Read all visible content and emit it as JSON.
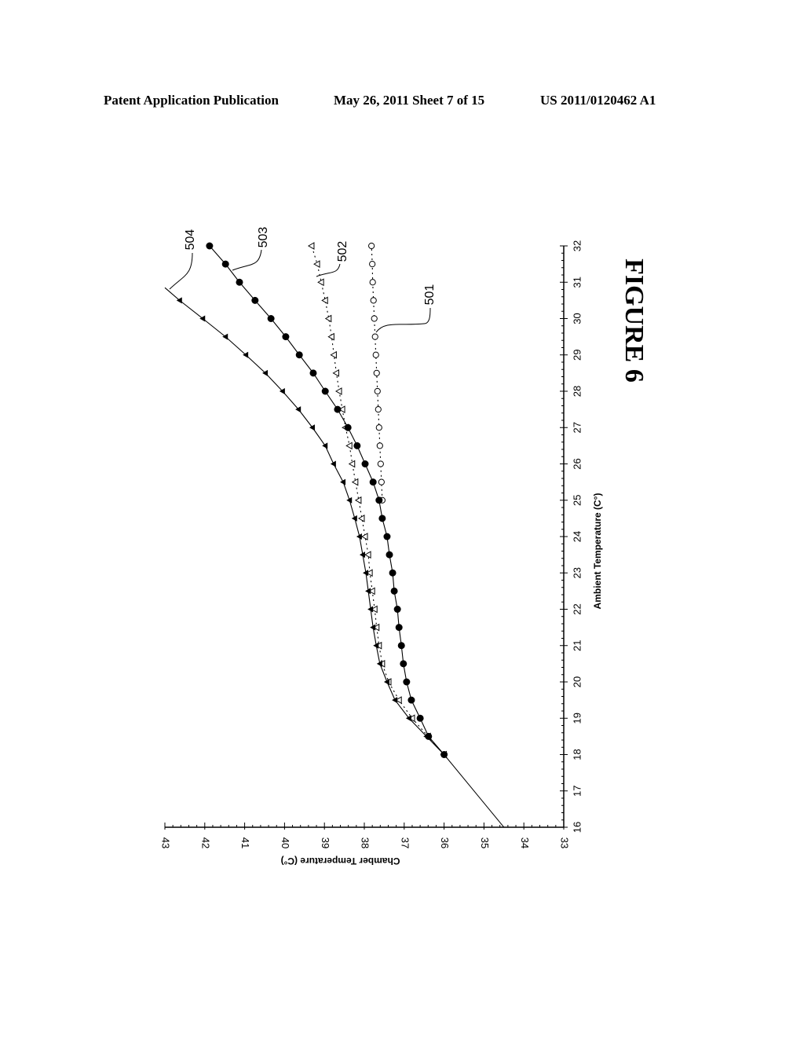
{
  "header": {
    "publication": "Patent Application Publication",
    "date_sheet": "May 26, 2011   Sheet 7 of 15",
    "patent_number": "US 2011/0120462 A1"
  },
  "figure_label": "FIGURE 6",
  "chart_data": {
    "type": "line",
    "orientation": "rotated 90 degrees clockwise on page",
    "title": "",
    "xlabel": "Ambient Temperature (C°)",
    "ylabel": "Chamber Temperature (C°)",
    "xlim": [
      16,
      32
    ],
    "ylim": [
      33,
      43
    ],
    "x_ticks": [
      "16",
      "17",
      "18",
      "19",
      "20",
      "21",
      "22",
      "23",
      "24",
      "25",
      "26",
      "27",
      "28",
      "29",
      "30",
      "31",
      "32"
    ],
    "y_ticks": [
      "33",
      "34",
      "35",
      "36",
      "37",
      "38",
      "39",
      "40",
      "41",
      "42",
      "43"
    ],
    "grid": false,
    "legend": "none (reference numerals with leader lines)",
    "baseline_segment": {
      "x": [
        16,
        18
      ],
      "y": [
        34.5,
        36.0
      ]
    },
    "series": [
      {
        "name": "501",
        "marker": "open-circle",
        "line": "dotted",
        "x": [
          25,
          25.5,
          26,
          26.5,
          27,
          27.5,
          28,
          28.5,
          29,
          29.5,
          30,
          30.5,
          31,
          31.5,
          32
        ],
        "y": [
          37.55,
          37.57,
          37.59,
          37.61,
          37.63,
          37.65,
          37.67,
          37.69,
          37.71,
          37.73,
          37.75,
          37.77,
          37.79,
          37.8,
          37.82
        ]
      },
      {
        "name": "502",
        "marker": "open-triangle",
        "line": "dotted",
        "x": [
          18,
          18.5,
          19,
          19.5,
          20,
          20.5,
          21,
          21.5,
          22,
          22.5,
          23,
          23.5,
          24,
          24.5,
          25,
          25.5,
          26,
          26.5,
          27,
          27.5,
          28,
          28.5,
          29,
          29.5,
          30,
          30.5,
          31,
          31.5,
          32
        ],
        "y": [
          36.0,
          36.4,
          36.8,
          37.13,
          37.39,
          37.55,
          37.63,
          37.69,
          37.74,
          37.8,
          37.86,
          37.9,
          37.98,
          38.06,
          38.14,
          38.22,
          38.3,
          38.37,
          38.47,
          38.55,
          38.63,
          38.7,
          38.76,
          38.82,
          38.89,
          38.98,
          39.08,
          39.18,
          39.32
        ]
      },
      {
        "name": "503",
        "marker": "filled-circle",
        "line": "solid",
        "x": [
          18,
          18.5,
          19,
          19.5,
          20,
          20.5,
          21,
          21.5,
          22,
          22.5,
          23,
          23.5,
          24,
          24.5,
          25,
          25.5,
          26,
          26.5,
          27,
          27.5,
          28,
          28.5,
          29,
          29.5,
          30,
          30.5,
          31,
          31.5,
          32
        ],
        "y": [
          36.0,
          36.39,
          36.6,
          36.82,
          36.94,
          37.02,
          37.07,
          37.13,
          37.17,
          37.25,
          37.29,
          37.37,
          37.43,
          37.55,
          37.63,
          37.78,
          37.98,
          38.18,
          38.41,
          38.67,
          38.98,
          39.28,
          39.63,
          39.97,
          40.34,
          40.74,
          41.13,
          41.48,
          41.88
        ]
      },
      {
        "name": "504",
        "marker": "filled-triangle",
        "line": "solid",
        "x": [
          18,
          18.5,
          19,
          19.5,
          20,
          20.5,
          21,
          21.5,
          22,
          22.5,
          23,
          23.5,
          24,
          24.5,
          25,
          25.5,
          26,
          26.5,
          27,
          27.5,
          28,
          28.5,
          29,
          29.5,
          30,
          30.5
        ],
        "y": [
          36.0,
          36.44,
          36.88,
          37.23,
          37.43,
          37.61,
          37.7,
          37.78,
          37.84,
          37.9,
          37.96,
          38.04,
          38.12,
          38.24,
          38.37,
          38.53,
          38.77,
          38.98,
          39.3,
          39.65,
          40.05,
          40.48,
          40.97,
          41.48,
          42.05,
          42.63
        ],
        "line_extends_to": {
          "x": 30.85,
          "y": 43.0
        }
      }
    ],
    "annotations": [
      "501",
      "502",
      "503",
      "504"
    ]
  }
}
